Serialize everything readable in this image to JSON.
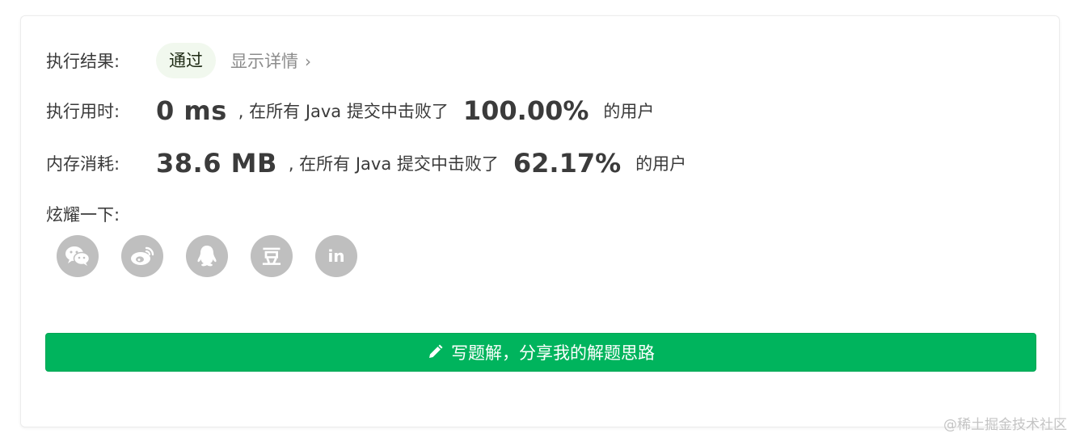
{
  "result": {
    "label": "执行结果:",
    "status": "通过",
    "details_link": "显示详情",
    "details_chevron": "›"
  },
  "runtime": {
    "label": "执行用时:",
    "value": "0 ms",
    "text_before": ", 在所有 Java 提交中击败了",
    "percent": "100.00%",
    "text_after": "的用户"
  },
  "memory": {
    "label": "内存消耗:",
    "value": "38.6 MB",
    "text_before": ", 在所有 Java 提交中击败了",
    "percent": "62.17%",
    "text_after": "的用户"
  },
  "share": {
    "label": "炫耀一下:",
    "icons": [
      "wechat-icon",
      "weibo-icon",
      "qq-icon",
      "douban-icon",
      "linkedin-icon"
    ],
    "douban_glyph": "豆",
    "linkedin_glyph": "in"
  },
  "solution_button": {
    "label": "写题解，分享我的解题思路",
    "icon": "pencil-icon"
  },
  "watermark": "@稀土掘金技术社区",
  "colors": {
    "accent": "#00b45d",
    "badge_bg": "#f1f8ee",
    "share_icon_bg": "#bfbfbf"
  }
}
